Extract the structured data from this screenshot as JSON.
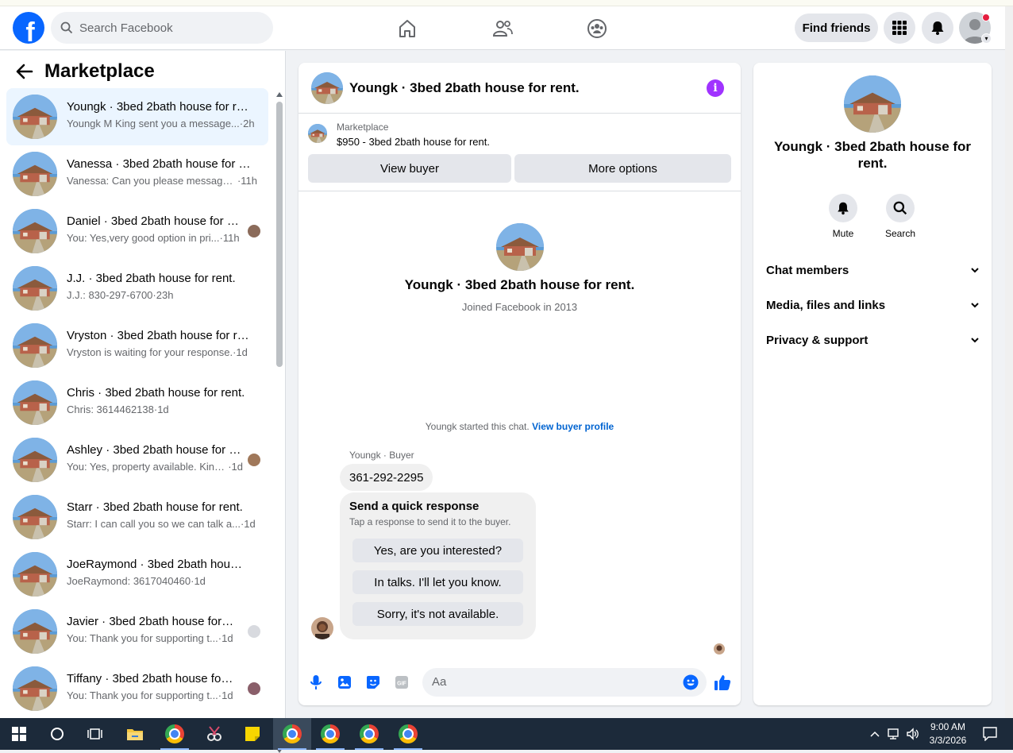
{
  "topbar": {
    "search_placeholder": "Search Facebook",
    "find_friends_label": "Find friends"
  },
  "sidebar": {
    "title": "Marketplace",
    "conversations": [
      {
        "title": "Youngk · 3bed 2bath house for rent.",
        "snippet": "Youngk M King sent you a message...",
        "time": "·2h",
        "active": true
      },
      {
        "title": "Vanessa · 3bed 2bath house for rent.",
        "snippet": "Vanessa: Can you please message ...",
        "time": "·11h"
      },
      {
        "title": "Daniel · 3bed 2bath house for rent.",
        "snippet": "You: Yes,very good option in pri...",
        "time": "·11h"
      },
      {
        "title": "J.J. · 3bed 2bath house for rent.",
        "snippet": "J.J.: 830-297-6700",
        "time": "·23h"
      },
      {
        "title": "Vryston · 3bed 2bath house for rent.",
        "snippet": "Vryston is waiting for your response.",
        "time": "·1d"
      },
      {
        "title": "Chris · 3bed 2bath house for rent.",
        "snippet": "Chris: 3614462138",
        "time": "·1d"
      },
      {
        "title": "Ashley · 3bed 2bath house for rent.",
        "snippet": "You: Yes, property available. Kind...",
        "time": "·1d"
      },
      {
        "title": "Starr · 3bed 2bath house for rent.",
        "snippet": "Starr: I can call you so we can talk a...",
        "time": "·1d"
      },
      {
        "title": "JoeRaymond · 3bed 2bath house for rent.",
        "snippet": "JoeRaymond: 3617040460",
        "time": "·1d"
      },
      {
        "title": "Javier · 3bed 2bath house for rent.",
        "snippet": "You: Thank you for supporting t...",
        "time": "·1d"
      },
      {
        "title": "Tiffany · 3bed 2bath house for rent.",
        "snippet": "You: Thank you for supporting t...",
        "time": "·1d"
      }
    ]
  },
  "chat": {
    "title": "Youngk · 3bed 2bath house for rent.",
    "marketplace_label": "Marketplace",
    "listing_price": "$950 - 3bed 2bath house for rent.",
    "view_buyer_label": "View buyer",
    "more_options_label": "More options",
    "profile_name": "Youngk · 3bed 2bath house for rent.",
    "joined_text": "Joined Facebook in 2013",
    "started_text": "Youngk started this chat.",
    "view_buyer_profile_link": "View buyer profile",
    "sender_label": "Youngk · Buyer",
    "message_text": "361-292-2295",
    "quick_response_title": "Send a quick response",
    "quick_response_subtitle": "Tap a response to send it to the buyer.",
    "quick_responses": [
      "Yes, are you interested?",
      "In talks. I'll let you know.",
      "Sorry, it's not available."
    ],
    "input_placeholder": "Aa"
  },
  "info_panel": {
    "name": "Youngk · 3bed 2bath house for rent.",
    "mute_label": "Mute",
    "search_label": "Search",
    "sections": [
      "Chat members",
      "Media, files and links",
      "Privacy & support"
    ]
  },
  "taskbar": {
    "time": "9:00 AM",
    "date": "3/3/2026"
  },
  "colors": {
    "brand_blue": "#0866ff",
    "active_conversation_bg": "#ebf5ff",
    "info_purple": "#a033ff",
    "link_blue": "#0064d1",
    "notification_red": "#e41e3f"
  }
}
